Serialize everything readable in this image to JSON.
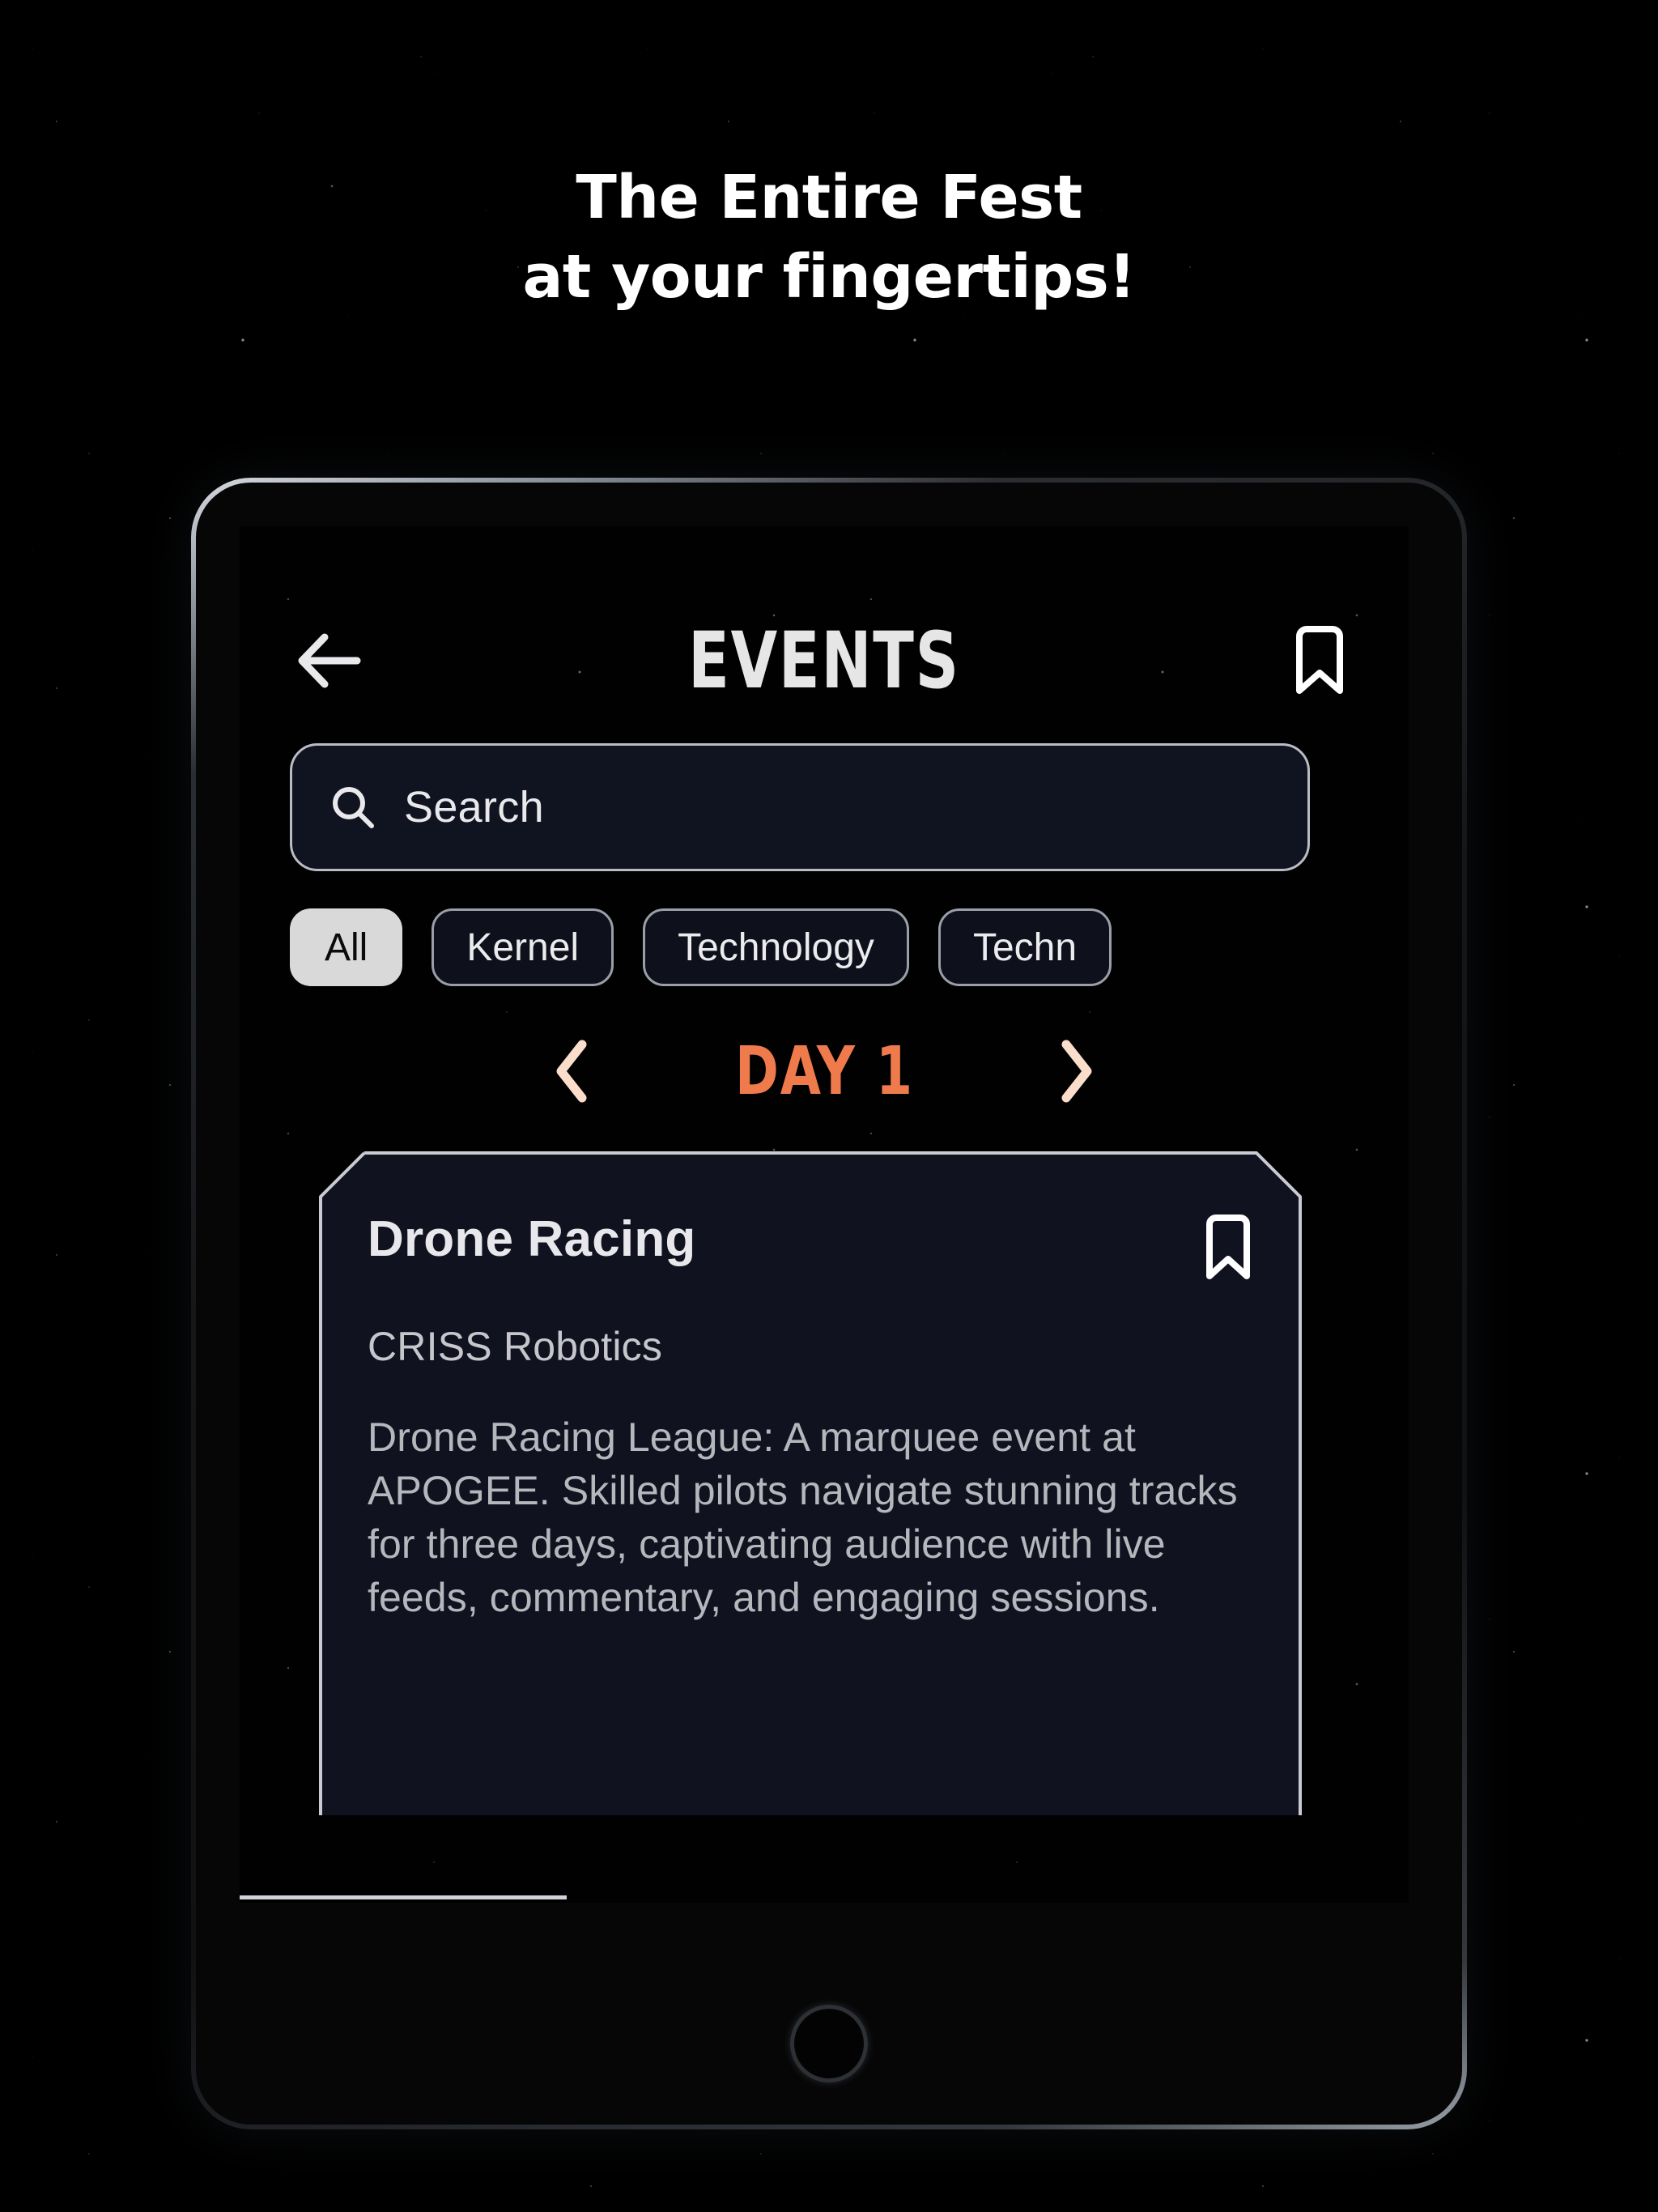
{
  "promo": {
    "headline_line1": "The Entire Fest",
    "headline_line2": "at your fingertips!"
  },
  "app": {
    "header": {
      "title": "EVENTS",
      "back_icon": "arrow-left-icon",
      "bookmark_icon": "bookmark-icon"
    },
    "search": {
      "placeholder": "Search",
      "value": "",
      "icon": "search-icon"
    },
    "filters": {
      "chips": [
        {
          "label": "All",
          "active": true
        },
        {
          "label": "Kernel",
          "active": false
        },
        {
          "label": "Technology",
          "active": false
        },
        {
          "label": "Techn",
          "active": false
        }
      ]
    },
    "day_nav": {
      "prev_icon": "chevron-left-icon",
      "next_icon": "chevron-right-icon",
      "label": "DAY 1"
    },
    "events": [
      {
        "title": "Drone Racing",
        "organizer": "CRISS Robotics",
        "description": "Drone Racing League: A marquee event at APOGEE. Skilled pilots navigate stunning tracks for three days, captivating audience with live feeds, commentary, and engaging sessions.",
        "bookmark_icon": "bookmark-icon"
      }
    ]
  },
  "colors": {
    "accent_orange": "#ef7b4c",
    "chevron_cream": "#fbddcc",
    "card_bg": "#10131f",
    "chip_active_bg": "#d9d9d9",
    "page_bg": "#000000",
    "title_gray": "#e6e6e6"
  }
}
